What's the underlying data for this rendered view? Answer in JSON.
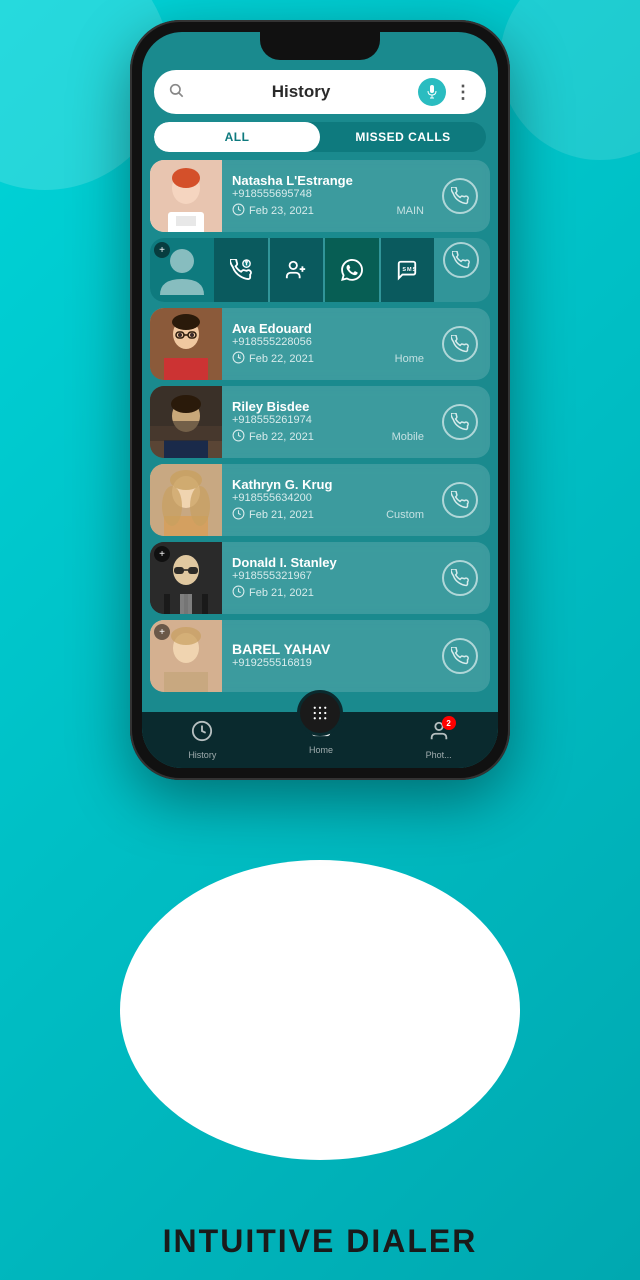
{
  "app": {
    "title": "INTUITIVE DIALER"
  },
  "search": {
    "placeholder": "History",
    "title": "History"
  },
  "tabs": {
    "all": "ALL",
    "missed": "MISSED CALLS"
  },
  "contacts": [
    {
      "id": 1,
      "name": "Natasha L'Estrange",
      "number": "+918555695748",
      "date": "Feb 23, 2021",
      "label": "MAIN",
      "avatar_class": "fake-photo-natasha",
      "has_photo": true
    },
    {
      "id": 2,
      "name": "",
      "number": "",
      "date": "",
      "label": "",
      "avatar_class": "",
      "is_expanded": true
    },
    {
      "id": 3,
      "name": "Ava Edouard",
      "number": "+918555228056",
      "date": "Feb 22, 2021",
      "label": "Home",
      "avatar_class": "fake-photo-ava",
      "has_photo": true
    },
    {
      "id": 4,
      "name": "Riley Bisdee",
      "number": "+918555261974",
      "date": "Feb 22, 2021",
      "label": "Mobile",
      "avatar_class": "fake-photo-riley",
      "has_photo": true
    },
    {
      "id": 5,
      "name": "Kathryn G. Krug",
      "number": "+918555634200",
      "date": "Feb 21, 2021",
      "label": "Custom",
      "avatar_class": "fake-photo-kathryn",
      "has_photo": true
    },
    {
      "id": 6,
      "name": "Donald I. Stanley",
      "number": "+918555321967",
      "date": "Feb 21, 2021",
      "label": "",
      "avatar_class": "fake-photo-donald",
      "has_photo": false,
      "has_plus": true
    },
    {
      "id": 7,
      "name": "BAREL YAHAV",
      "number": "+919255516819",
      "date": "",
      "label": "",
      "avatar_class": "fake-photo-barel",
      "has_photo": false,
      "has_plus": true
    }
  ],
  "action_buttons": {
    "info": "ℹ",
    "add_contact": "👤+",
    "whatsapp": "W",
    "sms": "SMS"
  },
  "bottom_nav": {
    "history": "History",
    "home": "Home",
    "photos": "Phot...",
    "badge_count": "2"
  }
}
